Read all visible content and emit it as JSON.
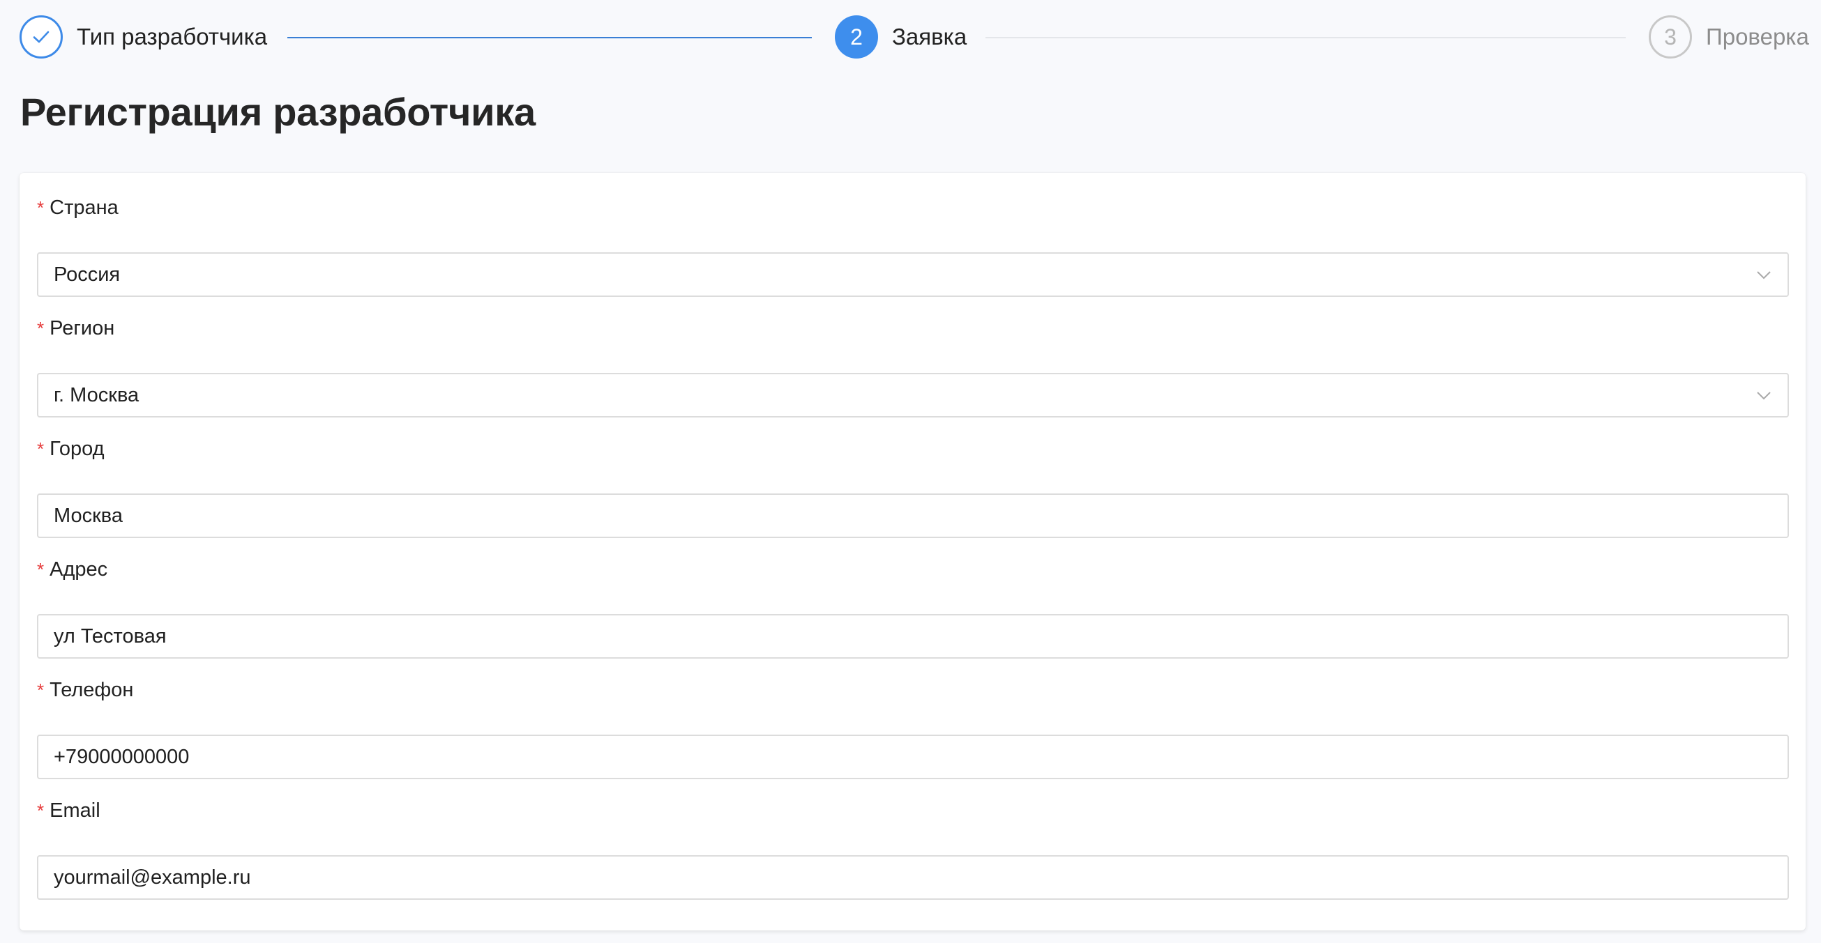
{
  "stepper": {
    "steps": [
      {
        "number": "",
        "label": "Тип разработчика",
        "state": "done"
      },
      {
        "number": "2",
        "label": "Заявка",
        "state": "active"
      },
      {
        "number": "3",
        "label": "Проверка",
        "state": "pending"
      }
    ]
  },
  "page": {
    "title": "Регистрация разработчика"
  },
  "form": {
    "required_mark": "*",
    "fields": [
      {
        "label": "Страна",
        "value": "Россия",
        "type": "select"
      },
      {
        "label": "Регион",
        "value": "г. Москва",
        "type": "select"
      },
      {
        "label": "Город",
        "value": "Москва",
        "type": "text"
      },
      {
        "label": "Адрес",
        "value": "ул Тестовая",
        "type": "text"
      },
      {
        "label": "Телефон",
        "value": "+79000000000",
        "type": "text"
      },
      {
        "label": "Email",
        "value": "yourmail@example.ru",
        "type": "text"
      }
    ]
  },
  "colors": {
    "accent": "#3e8eed",
    "required": "#e63c3c",
    "background": "#f8f9fc"
  }
}
